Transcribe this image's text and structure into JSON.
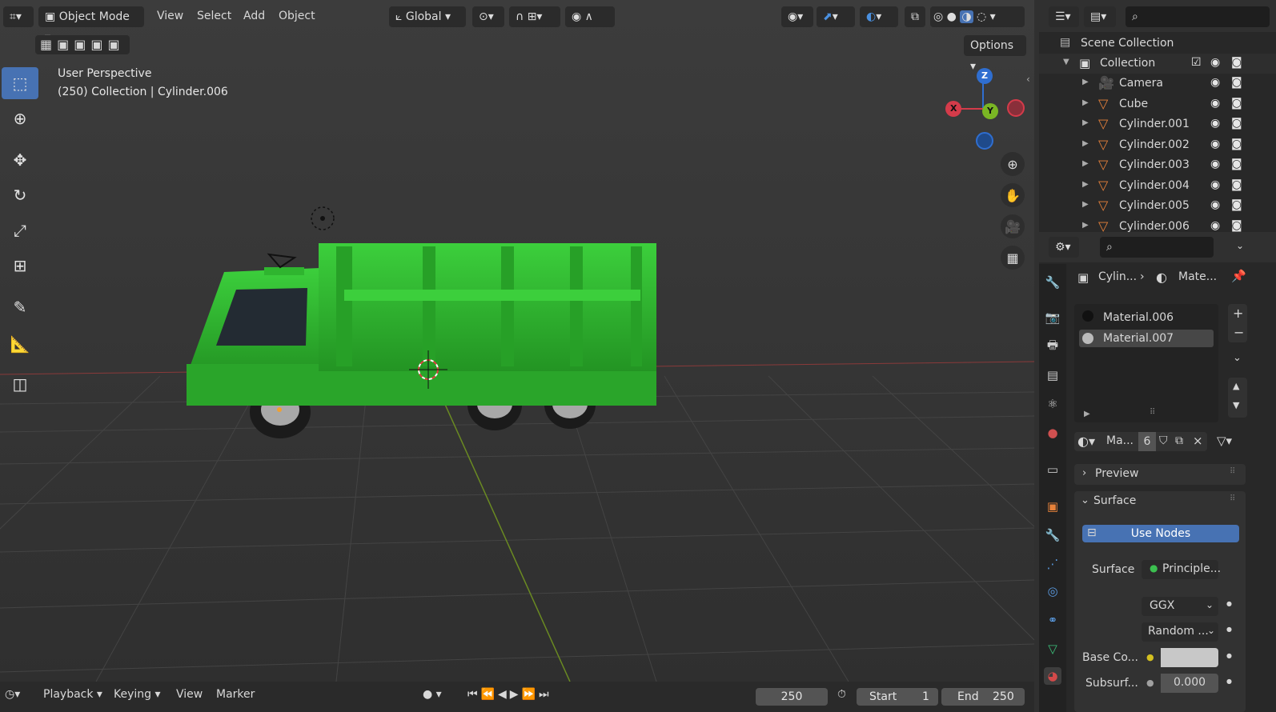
{
  "viewport": {
    "header": {
      "editor_icon": "editor-type-icon",
      "mode": "Object Mode",
      "menus": [
        "View",
        "Select",
        "Add",
        "Object"
      ],
      "transform": "Global",
      "options": "Options"
    },
    "overlay_text": {
      "perspective": "User Perspective",
      "collection": "(250) Collection | Cylinder.006"
    },
    "gizmo": {
      "z": "Z",
      "y": "Y",
      "x": "X"
    }
  },
  "outliner": {
    "scene_collection": "Scene Collection",
    "collection": "Collection",
    "items": [
      "Camera",
      "Cube",
      "Cylinder.001",
      "Cylinder.002",
      "Cylinder.003",
      "Cylinder.004",
      "Cylinder.005",
      "Cylinder.006"
    ]
  },
  "properties": {
    "breadcrumb_object": "Cylin...",
    "breadcrumb_material": "Mate...",
    "slots": [
      "Material.006",
      "Material.007"
    ],
    "material_name": "Ma...",
    "users_count": "6",
    "sections": {
      "preview": "Preview",
      "surface": "Surface"
    },
    "use_nodes": "Use Nodes",
    "surface_label": "Surface",
    "surface_value": "Principle...",
    "distribution": "GGX",
    "subsurface_method": "Random ...",
    "base_color_label": "Base Co...",
    "subsurface_label": "Subsurf...",
    "subsurface_value": "0.000"
  },
  "timeline": {
    "menus": [
      "Playback",
      "Keying",
      "View",
      "Marker"
    ],
    "current_frame": "250",
    "start_label": "Start",
    "start_value": "1",
    "end_label": "End",
    "end_value": "250"
  },
  "colors": {
    "accent": "#4772b3",
    "truck_green": "#2fb52f",
    "object_orange": "#e8823a"
  }
}
